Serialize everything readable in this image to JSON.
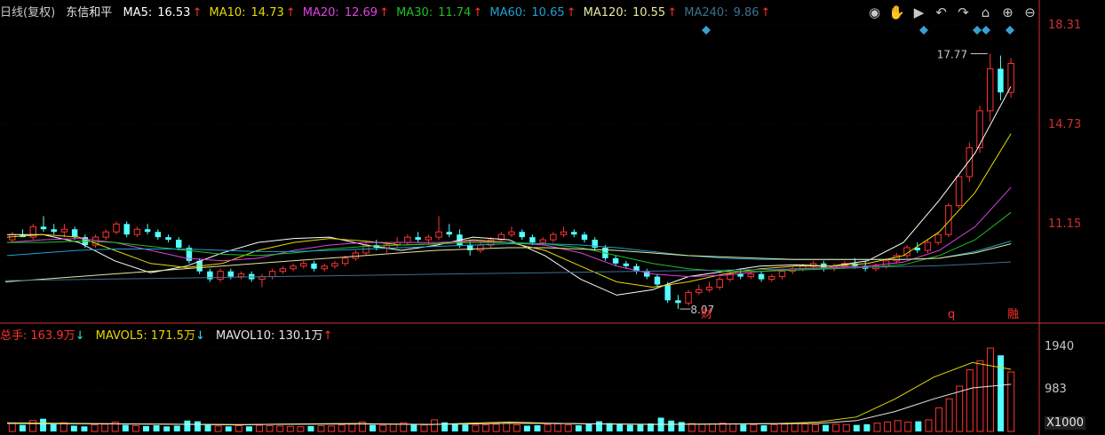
{
  "header": {
    "period": "日线(复权)",
    "name": "东信和平",
    "ma5": {
      "label": "MA5:",
      "value": "16.53",
      "arrow": "↑",
      "color": "#ffffff"
    },
    "ma10": {
      "label": "MA10:",
      "value": "14.73",
      "arrow": "↑",
      "color": "#e8d800"
    },
    "ma20": {
      "label": "MA20:",
      "value": "12.69",
      "arrow": "↑",
      "color": "#e040e0"
    },
    "ma30": {
      "label": "MA30:",
      "value": "11.74",
      "arrow": "↑",
      "color": "#20c020"
    },
    "ma60": {
      "label": "MA60:",
      "value": "10.65",
      "arrow": "↑",
      "color": "#20a0d0"
    },
    "ma120": {
      "label": "MA120:",
      "value": "10.55",
      "arrow": "↑",
      "color": "#e8e8a0"
    },
    "ma240": {
      "label": "MA240:",
      "value": "9.86",
      "arrow": "↑",
      "color": "#3a7090"
    }
  },
  "vol_header": {
    "total": {
      "label": "总手:",
      "value": "163.9万",
      "arrow": "↓",
      "color": "#ff3030"
    },
    "mavol5": {
      "label": "MAVOL5:",
      "value": "171.5万",
      "arrow": "↓",
      "color": "#e8d800"
    },
    "mavol10": {
      "label": "MAVOL10:",
      "value": "130.1万",
      "arrow": "↑",
      "color": "#e8e8e8"
    }
  },
  "toolbar": {
    "icons": [
      "eye-icon",
      "hand-icon",
      "play-icon",
      "undo-icon",
      "redo-icon",
      "lock-icon",
      "zoom-in-icon",
      "zoom-out-icon"
    ]
  },
  "colors": {
    "up": "#ff3232",
    "down": "#54ffff",
    "grid": "#3a0000",
    "axis": "#d03030"
  },
  "chart_data": {
    "type": "candlestick",
    "price_axis": {
      "ticks": [
        "18.31",
        "14.73",
        "11.15"
      ],
      "ylim": [
        7.6,
        18.8
      ]
    },
    "volume_axis": {
      "ticks": [
        "1940",
        "983"
      ],
      "unit": "X1000"
    },
    "annotations": {
      "high": "17.77",
      "low": "8.07",
      "markers": [
        "财",
        "q",
        "融"
      ]
    },
    "candles": [
      [
        10.7,
        11.0,
        10.6,
        10.9
      ],
      [
        10.9,
        11.1,
        10.8,
        10.8
      ],
      [
        10.8,
        11.3,
        10.7,
        11.2
      ],
      [
        11.2,
        11.6,
        11.0,
        11.1
      ],
      [
        11.1,
        11.3,
        10.9,
        11.0
      ],
      [
        11.0,
        11.3,
        10.8,
        11.1
      ],
      [
        11.1,
        11.2,
        10.7,
        10.8
      ],
      [
        10.8,
        10.9,
        10.4,
        10.5
      ],
      [
        10.5,
        10.9,
        10.4,
        10.8
      ],
      [
        10.8,
        11.1,
        10.7,
        11.0
      ],
      [
        11.0,
        11.4,
        10.9,
        11.3
      ],
      [
        11.3,
        11.4,
        10.8,
        10.9
      ],
      [
        10.9,
        11.2,
        10.8,
        11.1
      ],
      [
        11.1,
        11.3,
        10.9,
        11.0
      ],
      [
        11.0,
        11.1,
        10.7,
        10.8
      ],
      [
        10.8,
        10.9,
        10.6,
        10.7
      ],
      [
        10.7,
        10.8,
        10.3,
        10.4
      ],
      [
        10.4,
        10.5,
        9.8,
        9.9
      ],
      [
        9.9,
        10.0,
        9.4,
        9.5
      ],
      [
        9.5,
        9.6,
        9.1,
        9.2
      ],
      [
        9.2,
        9.6,
        9.1,
        9.5
      ],
      [
        9.5,
        9.6,
        9.2,
        9.3
      ],
      [
        9.3,
        9.5,
        9.2,
        9.4
      ],
      [
        9.4,
        9.5,
        9.1,
        9.2
      ],
      [
        9.2,
        9.4,
        8.9,
        9.3
      ],
      [
        9.3,
        9.6,
        9.2,
        9.5
      ],
      [
        9.5,
        9.7,
        9.4,
        9.6
      ],
      [
        9.6,
        9.8,
        9.5,
        9.7
      ],
      [
        9.7,
        9.9,
        9.6,
        9.8
      ],
      [
        9.8,
        9.9,
        9.5,
        9.6
      ],
      [
        9.6,
        9.8,
        9.5,
        9.7
      ],
      [
        9.7,
        9.9,
        9.6,
        9.8
      ],
      [
        9.8,
        10.1,
        9.7,
        10.0
      ],
      [
        10.0,
        10.3,
        9.9,
        10.2
      ],
      [
        10.2,
        10.6,
        10.1,
        10.5
      ],
      [
        10.5,
        10.7,
        10.3,
        10.4
      ],
      [
        10.4,
        10.6,
        10.2,
        10.5
      ],
      [
        10.5,
        10.8,
        10.4,
        10.6
      ],
      [
        10.6,
        10.9,
        10.5,
        10.8
      ],
      [
        10.8,
        11.0,
        10.6,
        10.7
      ],
      [
        10.7,
        10.9,
        10.5,
        10.8
      ],
      [
        10.8,
        11.6,
        10.7,
        11.0
      ],
      [
        11.0,
        11.3,
        10.8,
        10.9
      ],
      [
        10.9,
        11.1,
        10.4,
        10.5
      ],
      [
        10.5,
        10.7,
        10.1,
        10.3
      ],
      [
        10.3,
        10.6,
        10.2,
        10.5
      ],
      [
        10.5,
        10.8,
        10.4,
        10.7
      ],
      [
        10.7,
        11.0,
        10.6,
        10.9
      ],
      [
        10.9,
        11.2,
        10.8,
        11.0
      ],
      [
        11.0,
        11.1,
        10.7,
        10.8
      ],
      [
        10.8,
        10.9,
        10.5,
        10.6
      ],
      [
        10.6,
        10.8,
        10.5,
        10.7
      ],
      [
        10.7,
        11.0,
        10.6,
        10.9
      ],
      [
        10.9,
        11.2,
        10.8,
        11.0
      ],
      [
        11.0,
        11.1,
        10.8,
        10.9
      ],
      [
        10.9,
        11.0,
        10.6,
        10.7
      ],
      [
        10.7,
        10.8,
        10.3,
        10.4
      ],
      [
        10.4,
        10.5,
        9.9,
        10.0
      ],
      [
        10.0,
        10.1,
        9.7,
        9.8
      ],
      [
        9.8,
        9.9,
        9.6,
        9.7
      ],
      [
        9.7,
        9.8,
        9.4,
        9.5
      ],
      [
        9.5,
        9.6,
        9.2,
        9.3
      ],
      [
        9.3,
        9.4,
        8.9,
        9.0
      ],
      [
        9.0,
        9.1,
        8.3,
        8.4
      ],
      [
        8.4,
        8.6,
        8.07,
        8.3
      ],
      [
        8.3,
        8.8,
        8.2,
        8.7
      ],
      [
        8.7,
        9.0,
        8.6,
        8.8
      ],
      [
        8.8,
        9.1,
        8.7,
        8.9
      ],
      [
        8.9,
        9.3,
        8.8,
        9.2
      ],
      [
        9.2,
        9.5,
        9.1,
        9.4
      ],
      [
        9.4,
        9.6,
        9.2,
        9.3
      ],
      [
        9.3,
        9.5,
        9.2,
        9.4
      ],
      [
        9.4,
        9.5,
        9.1,
        9.2
      ],
      [
        9.2,
        9.4,
        9.1,
        9.3
      ],
      [
        9.3,
        9.6,
        9.2,
        9.5
      ],
      [
        9.5,
        9.7,
        9.4,
        9.6
      ],
      [
        9.6,
        9.8,
        9.5,
        9.7
      ],
      [
        9.7,
        9.9,
        9.6,
        9.8
      ],
      [
        9.8,
        9.9,
        9.5,
        9.6
      ],
      [
        9.6,
        9.8,
        9.5,
        9.7
      ],
      [
        9.7,
        9.9,
        9.6,
        9.8
      ],
      [
        9.8,
        10.0,
        9.6,
        9.7
      ],
      [
        9.7,
        9.9,
        9.5,
        9.6
      ],
      [
        9.6,
        9.8,
        9.5,
        9.7
      ],
      [
        9.7,
        10.0,
        9.6,
        9.9
      ],
      [
        9.9,
        10.2,
        9.8,
        10.1
      ],
      [
        10.1,
        10.5,
        10.0,
        10.4
      ],
      [
        10.4,
        10.6,
        10.2,
        10.3
      ],
      [
        10.3,
        10.7,
        10.2,
        10.6
      ],
      [
        10.6,
        11.0,
        10.5,
        10.9
      ],
      [
        10.9,
        12.1,
        10.8,
        12.0
      ],
      [
        12.0,
        13.2,
        11.9,
        13.1
      ],
      [
        13.1,
        14.4,
        12.9,
        14.2
      ],
      [
        14.2,
        15.8,
        14.0,
        15.6
      ],
      [
        15.6,
        17.77,
        15.2,
        17.2
      ],
      [
        17.2,
        17.7,
        16.0,
        16.3
      ],
      [
        16.3,
        17.6,
        16.1,
        17.4
      ]
    ],
    "ma_lines": {
      "MA5": [
        10.9,
        10.9,
        10.6,
        9.9,
        9.45,
        9.7,
        10.2,
        10.6,
        10.75,
        10.8,
        10.5,
        10.3,
        10.5,
        10.8,
        10.7,
        10.1,
        9.2,
        8.6,
        8.8,
        9.3,
        9.5,
        9.7,
        9.75,
        9.7,
        9.9,
        10.6,
        12.2,
        14.0,
        16.53
      ],
      "MA10": [
        10.8,
        10.9,
        10.8,
        10.3,
        9.8,
        9.65,
        9.8,
        10.3,
        10.6,
        10.75,
        10.65,
        10.5,
        10.55,
        10.7,
        10.6,
        10.3,
        9.7,
        9.1,
        8.9,
        9.1,
        9.4,
        9.6,
        9.7,
        9.7,
        9.8,
        10.1,
        11.0,
        12.5,
        14.73
      ],
      "MA20": [
        10.6,
        10.7,
        10.75,
        10.6,
        10.3,
        10.0,
        9.9,
        10.0,
        10.3,
        10.5,
        10.6,
        10.6,
        10.6,
        10.65,
        10.6,
        10.5,
        10.2,
        9.7,
        9.4,
        9.3,
        9.35,
        9.5,
        9.6,
        9.65,
        9.7,
        9.85,
        10.3,
        11.2,
        12.69
      ],
      "MA30": [
        10.6,
        10.6,
        10.65,
        10.6,
        10.45,
        10.3,
        10.15,
        10.1,
        10.2,
        10.35,
        10.45,
        10.5,
        10.55,
        10.6,
        10.6,
        10.55,
        10.4,
        10.1,
        9.8,
        9.6,
        9.5,
        9.5,
        9.55,
        9.6,
        9.65,
        9.75,
        10.1,
        10.7,
        11.74
      ],
      "MA60": [
        10.1,
        10.2,
        10.3,
        10.35,
        10.35,
        10.35,
        10.3,
        10.25,
        10.25,
        10.3,
        10.35,
        10.4,
        10.45,
        10.5,
        10.55,
        10.55,
        10.5,
        10.4,
        10.25,
        10.1,
        10.0,
        9.95,
        9.95,
        9.95,
        9.95,
        9.95,
        10.0,
        10.25,
        10.65
      ],
      "MA120": [
        9.1,
        9.2,
        9.3,
        9.4,
        9.5,
        9.6,
        9.7,
        9.8,
        9.9,
        10.0,
        10.1,
        10.2,
        10.3,
        10.35,
        10.4,
        10.4,
        10.35,
        10.3,
        10.2,
        10.1,
        10.05,
        10.0,
        9.95,
        9.95,
        9.95,
        9.95,
        10.0,
        10.2,
        10.55
      ],
      "MA240": [
        9.15,
        9.17,
        9.19,
        9.21,
        9.23,
        9.25,
        9.27,
        9.29,
        9.31,
        9.33,
        9.35,
        9.37,
        9.39,
        9.41,
        9.43,
        9.45,
        9.47,
        9.49,
        9.51,
        9.53,
        9.55,
        9.57,
        9.59,
        9.62,
        9.65,
        9.68,
        9.72,
        9.78,
        9.86
      ]
    },
    "volumes": [
      220,
      180,
      300,
      350,
      200,
      240,
      160,
      140,
      180,
      200,
      260,
      180,
      160,
      150,
      170,
      140,
      160,
      300,
      280,
      200,
      150,
      140,
      160,
      140,
      170,
      160,
      150,
      140,
      130,
      150,
      160,
      150,
      180,
      200,
      260,
      180,
      170,
      200,
      240,
      190,
      180,
      320,
      250,
      220,
      190,
      170,
      180,
      200,
      220,
      180,
      160,
      170,
      190,
      210,
      180,
      170,
      200,
      280,
      230,
      200,
      180,
      190,
      220,
      380,
      300,
      260,
      220,
      200,
      210,
      230,
      210,
      190,
      180,
      170,
      190,
      200,
      220,
      210,
      190,
      180,
      200,
      190,
      180,
      200,
      230,
      260,
      300,
      260,
      280,
      320,
      650,
      900,
      1250,
      1700,
      1950,
      2300,
      2100,
      1640
    ],
    "mavol5": [
      240,
      230,
      220,
      210,
      200,
      190,
      180,
      200,
      210,
      220,
      200,
      190,
      230,
      260,
      230,
      210,
      200,
      190,
      200,
      210,
      220,
      260,
      400,
      900,
      1500,
      1900,
      1715
    ],
    "mavol10": [
      220,
      215,
      210,
      205,
      200,
      195,
      190,
      195,
      200,
      205,
      200,
      195,
      205,
      225,
      220,
      210,
      200,
      195,
      200,
      205,
      210,
      220,
      300,
      550,
      900,
      1200,
      1301
    ]
  }
}
